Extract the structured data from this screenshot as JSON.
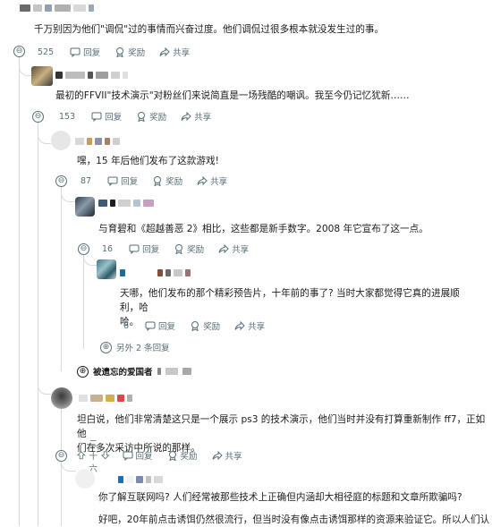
{
  "c0": {
    "text": "千万别因为他们\"调侃\"过的事情而兴奋过度。他们调侃过很多根本就没发生过的事。",
    "votes": "525"
  },
  "c1": {
    "text": "最初的FFVII\"技术演示\"对粉丝们来说简直是一场残酷的嘲讽。我至今仍记忆犹新……",
    "votes": "153"
  },
  "c2": {
    "text": "嘿，15 年后他们发布了这款游戏!",
    "votes": "87"
  },
  "c3": {
    "text": "与育碧和《超越善恶 2》相比，这些都是新手数字。2008 年它宣布了这一点。",
    "votes": "16"
  },
  "c4": {
    "text_l1": "天哪，他们发布的那个精彩预告片，十年前的事了? 当时大家都觉得它真的进展顺利，哈",
    "text_l2": "哈。",
    "votes": "6"
  },
  "c5": {
    "text_l1": "坦白说，他们非常清楚这只是一个展示 ps3 的技术演示，他们当时并没有打算重新制作 ff7，正如他",
    "text_l2": "们在多次采访中所说的那样。",
    "votes": "二十六"
  },
  "c6": {
    "text": "你了解互联网吗? 人们经常被那些技术上正确但内涵却大相径庭的标题和文章所欺骗吗?"
  },
  "c7": {
    "text": "好吧，20年前点击诱饵仍然很流行，但当时没有像点击诱饵那样的资源来验证它。所以人们认"
  },
  "labels": {
    "reply": "回复",
    "award": "奖励",
    "share": "共享"
  },
  "more_replies": "另外 2 条回复",
  "deleted_user": "被遗忘的爱国者",
  "collapse_symbol": "⊖",
  "expand_symbol": "⊕",
  "colors": {
    "meta": "#576f76",
    "line": "#d7dadc",
    "text": "#1c1c1c"
  }
}
